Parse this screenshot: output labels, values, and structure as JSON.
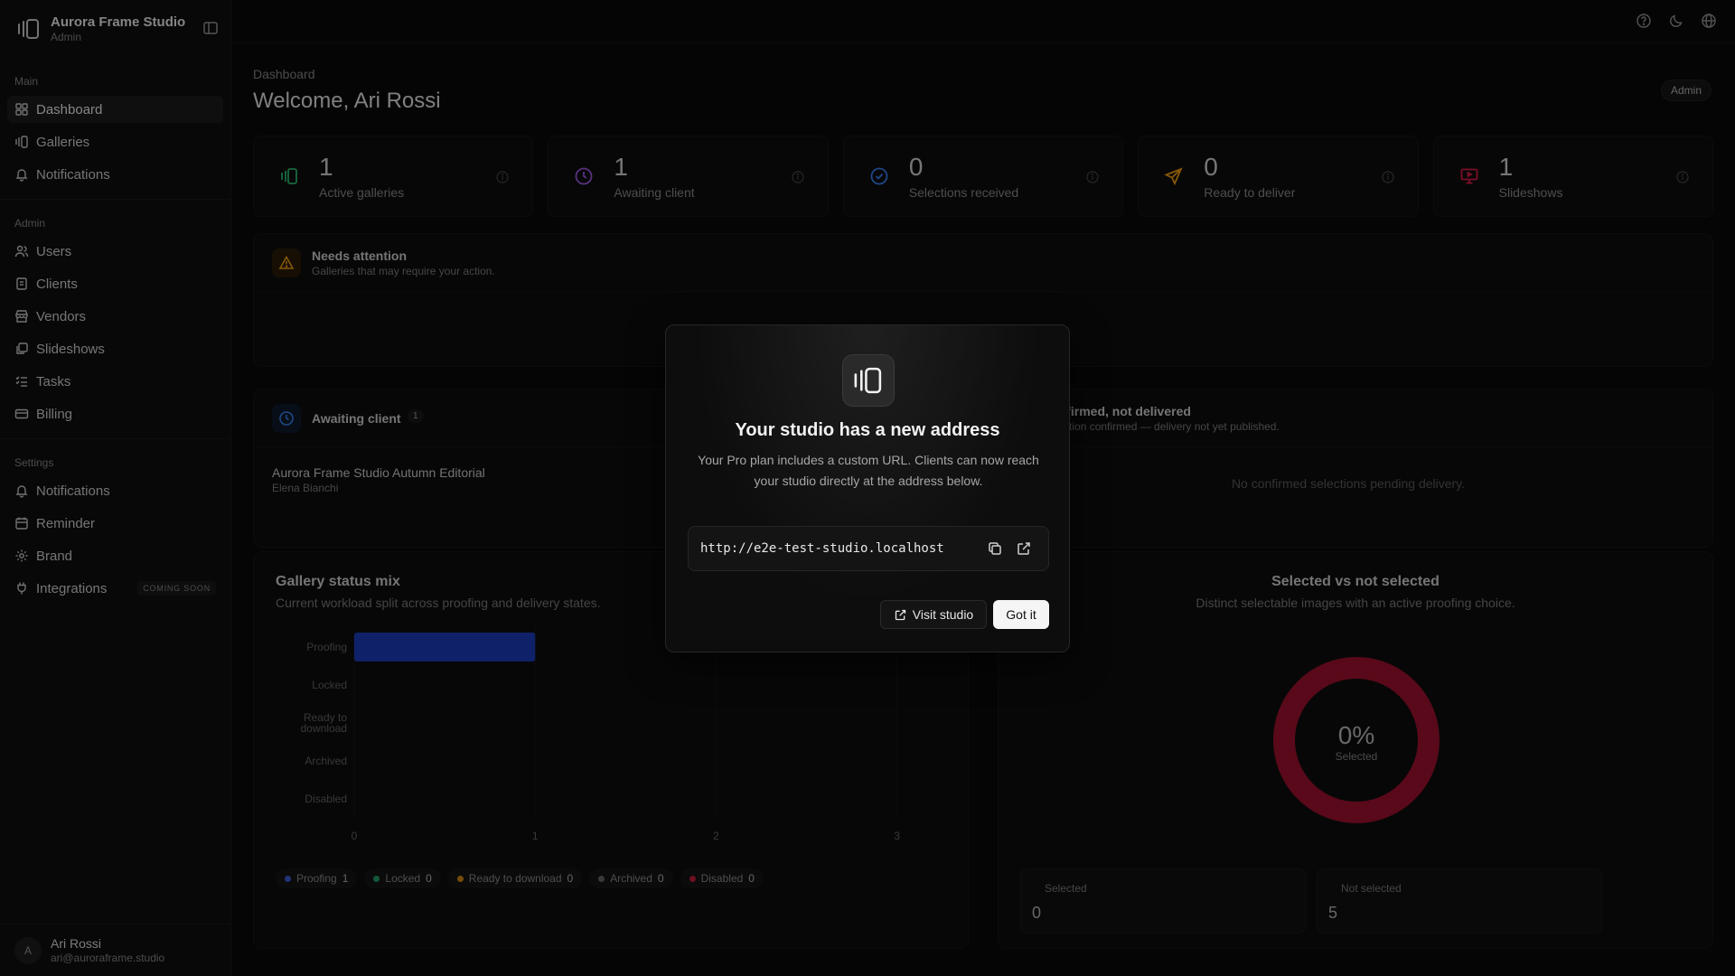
{
  "brand": {
    "name": "Aurora Frame Studio",
    "role": "Admin"
  },
  "nav": {
    "main_heading": "Main",
    "main_items": [
      {
        "label": "Dashboard",
        "icon": "dashboard-icon"
      },
      {
        "label": "Galleries",
        "icon": "galleries-icon"
      },
      {
        "label": "Notifications",
        "icon": "bell-icon"
      }
    ],
    "admin_heading": "Admin",
    "admin_items": [
      {
        "label": "Users",
        "icon": "users-icon"
      },
      {
        "label": "Clients",
        "icon": "clients-icon"
      },
      {
        "label": "Vendors",
        "icon": "store-icon"
      },
      {
        "label": "Slideshows",
        "icon": "slideshow-icon"
      },
      {
        "label": "Tasks",
        "icon": "tasks-icon"
      },
      {
        "label": "Billing",
        "icon": "card-icon"
      }
    ],
    "settings_heading": "Settings",
    "settings_items": [
      {
        "label": "Notifications",
        "icon": "bell-icon"
      },
      {
        "label": "Reminder",
        "icon": "calendar-icon"
      },
      {
        "label": "Brand",
        "icon": "gear-icon"
      },
      {
        "label": "Integrations",
        "icon": "plug-icon"
      }
    ],
    "coming_soon": "COMING SOON"
  },
  "user": {
    "initial": "A",
    "name": "Ari Rossi",
    "email": "ari@auroraframe.studio"
  },
  "header": {
    "breadcrumb": "Dashboard",
    "title": "Welcome, Ari Rossi",
    "role_badge": "Admin"
  },
  "stats": [
    {
      "value": "1",
      "label": "Active galleries",
      "icon": "galleries-icon",
      "color": "#2fbf71"
    },
    {
      "value": "1",
      "label": "Awaiting client",
      "icon": "clock-icon",
      "color": "#a259e6"
    },
    {
      "value": "0",
      "label": "Selections received",
      "icon": "check-circle-icon",
      "color": "#3b82f6"
    },
    {
      "value": "0",
      "label": "Ready to deliver",
      "icon": "send-icon",
      "color": "#f59e0b"
    },
    {
      "value": "1",
      "label": "Slideshows",
      "icon": "slideshow-icon",
      "color": "#e11d48"
    }
  ],
  "attention": {
    "title": "Needs attention",
    "subtitle": "Galleries that may require your action."
  },
  "awaiting": {
    "title": "Awaiting client",
    "count": "1",
    "row_title": "Aurora Frame Studio Autumn Editorial",
    "row_sub": "Elena Bianchi"
  },
  "confirmed": {
    "title": "Confirmed, not delivered",
    "subtitle": "Selection confirmed — delivery not yet published.",
    "empty": "No confirmed selections pending delivery."
  },
  "status_chart": {
    "title": "Gallery status mix",
    "subtitle": "Current workload split across proofing and delivery states."
  },
  "selection_chart": {
    "title": "Selected vs not selected",
    "subtitle": "Distinct selectable images with an active proofing choice.",
    "center_value": "0%",
    "center_label": "Selected",
    "selected_label": "Selected",
    "selected_value": "0",
    "not_selected_label": "Not selected",
    "not_selected_value": "5"
  },
  "chart_data": [
    {
      "type": "bar",
      "orientation": "horizontal",
      "categories": [
        "Proofing",
        "Locked",
        "Ready to download",
        "Archived",
        "Disabled"
      ],
      "values": [
        1,
        0,
        0,
        0,
        0
      ],
      "xlim": [
        0,
        4
      ],
      "xticks": [
        "0",
        "1",
        "2",
        "3",
        "4"
      ],
      "colors": [
        "#1d3fbf",
        "#22a06b",
        "#d98a12",
        "#6b6b6b",
        "#c81e3c"
      ],
      "legend": [
        {
          "name": "Proofing",
          "value": "1"
        },
        {
          "name": "Locked",
          "value": "0"
        },
        {
          "name": "Ready to download",
          "value": "0"
        },
        {
          "name": "Archived",
          "value": "0"
        },
        {
          "name": "Disabled",
          "value": "0"
        }
      ]
    },
    {
      "type": "pie",
      "categories": [
        "Selected",
        "Not selected"
      ],
      "values": [
        0,
        5
      ],
      "colors": [
        "#3b82f6",
        "#a3122f"
      ]
    }
  ],
  "modal": {
    "title": "Your studio has a new address",
    "body": "Your Pro plan includes a custom URL. Clients can now reach your studio directly at the address below.",
    "url": "http://e2e-test-studio.localhost",
    "visit_label": "Visit studio",
    "got_it_label": "Got it"
  }
}
